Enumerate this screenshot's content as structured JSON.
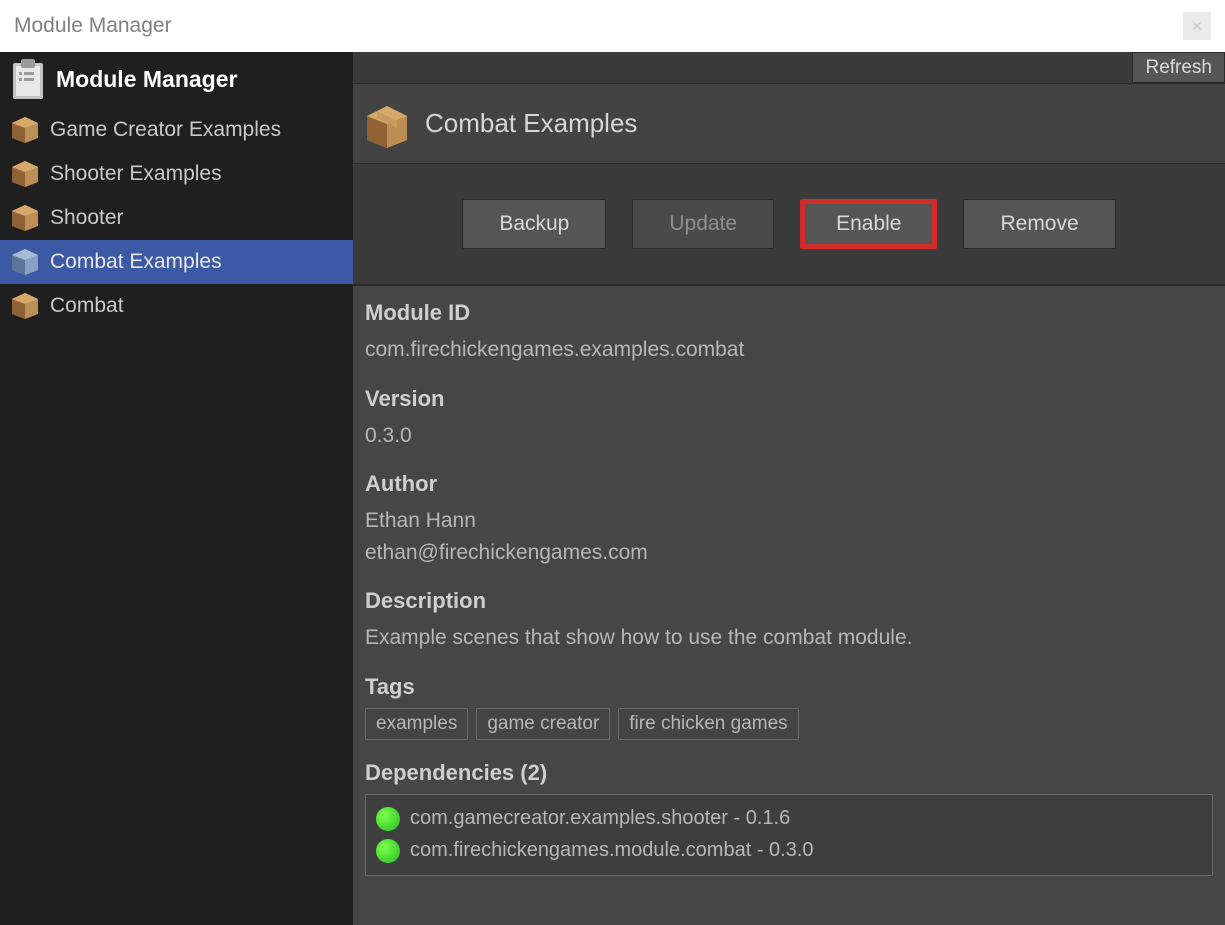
{
  "window": {
    "title": "Module Manager"
  },
  "sidebar": {
    "title": "Module Manager",
    "items": [
      {
        "label": "Game Creator Examples",
        "selected": false
      },
      {
        "label": "Shooter Examples",
        "selected": false
      },
      {
        "label": "Shooter",
        "selected": false
      },
      {
        "label": "Combat Examples",
        "selected": true
      },
      {
        "label": "Combat",
        "selected": false
      }
    ]
  },
  "topbar": {
    "refresh_label": "Refresh"
  },
  "module": {
    "title": "Combat Examples",
    "actions": {
      "backup": "Backup",
      "update": "Update",
      "enable": "Enable",
      "remove": "Remove"
    },
    "fields": {
      "module_id_label": "Module ID",
      "module_id": "com.firechickengames.examples.combat",
      "version_label": "Version",
      "version": "0.3.0",
      "author_label": "Author",
      "author_name": "Ethan Hann",
      "author_email": "ethan@firechickengames.com",
      "description_label": "Description",
      "description": "Example scenes that show how to use the combat module.",
      "tags_label": "Tags",
      "tags": [
        "examples",
        "game creator",
        "fire chicken games"
      ],
      "deps_label": "Dependencies (2)",
      "deps": [
        {
          "text": "com.gamecreator.examples.shooter - 0.1.6",
          "status": "ok"
        },
        {
          "text": "com.firechickengames.module.combat - 0.3.0",
          "status": "ok"
        }
      ]
    }
  }
}
